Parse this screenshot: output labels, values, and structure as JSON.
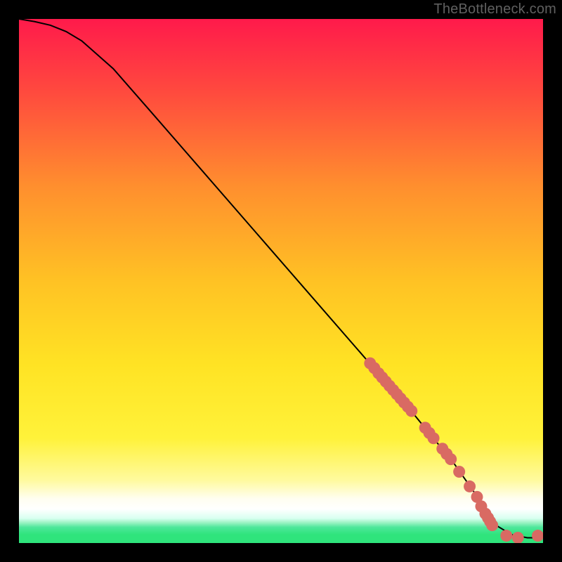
{
  "watermark": "TheBottleneck.com",
  "colors": {
    "background": "#000000",
    "curve": "#000000",
    "marker_fill": "#d96a63",
    "marker_stroke": "#c95b54",
    "green": "#2fe47c",
    "red_top": "#ff1a4b",
    "orange_mid": "#ffb224",
    "yellow_mid": "#ffe324",
    "pale_yellow": "#fff9c8",
    "white_band": "#ffffff"
  },
  "chart_data": {
    "type": "line",
    "title": "",
    "xlabel": "",
    "ylabel": "",
    "xlim": [
      0,
      100
    ],
    "ylim": [
      0,
      100
    ],
    "curve": {
      "x": [
        0,
        3,
        6,
        9,
        12,
        18,
        25,
        35,
        45,
        55,
        65,
        75,
        83,
        87,
        89,
        91,
        94,
        97,
        100
      ],
      "y": [
        100,
        99.5,
        98.8,
        97.6,
        95.8,
        90.5,
        82.5,
        71.0,
        59.5,
        48.0,
        36.5,
        25.0,
        15.2,
        9.5,
        5.8,
        3.4,
        1.6,
        1.0,
        1.0
      ]
    },
    "series": [
      {
        "name": "markers",
        "points": [
          {
            "x": 67.0,
            "y": 34.3
          },
          {
            "x": 67.8,
            "y": 33.4
          },
          {
            "x": 68.6,
            "y": 32.4
          },
          {
            "x": 69.3,
            "y": 31.6
          },
          {
            "x": 70.0,
            "y": 30.8
          },
          {
            "x": 70.7,
            "y": 30.0
          },
          {
            "x": 71.4,
            "y": 29.2
          },
          {
            "x": 72.1,
            "y": 28.4
          },
          {
            "x": 72.8,
            "y": 27.6
          },
          {
            "x": 73.5,
            "y": 26.8
          },
          {
            "x": 74.2,
            "y": 26.0
          },
          {
            "x": 74.9,
            "y": 25.2
          },
          {
            "x": 77.5,
            "y": 22.0
          },
          {
            "x": 78.3,
            "y": 21.0
          },
          {
            "x": 79.1,
            "y": 20.0
          },
          {
            "x": 80.8,
            "y": 18.0
          },
          {
            "x": 81.6,
            "y": 17.0
          },
          {
            "x": 82.4,
            "y": 16.0
          },
          {
            "x": 84.0,
            "y": 13.6
          },
          {
            "x": 86.0,
            "y": 10.8
          },
          {
            "x": 87.4,
            "y": 8.8
          },
          {
            "x": 88.2,
            "y": 7.0
          },
          {
            "x": 89.0,
            "y": 5.6
          },
          {
            "x": 89.5,
            "y": 4.8
          },
          {
            "x": 89.9,
            "y": 4.1
          },
          {
            "x": 90.3,
            "y": 3.4
          },
          {
            "x": 93.0,
            "y": 1.4
          },
          {
            "x": 95.2,
            "y": 1.0
          },
          {
            "x": 99.0,
            "y": 1.4
          }
        ]
      }
    ]
  }
}
